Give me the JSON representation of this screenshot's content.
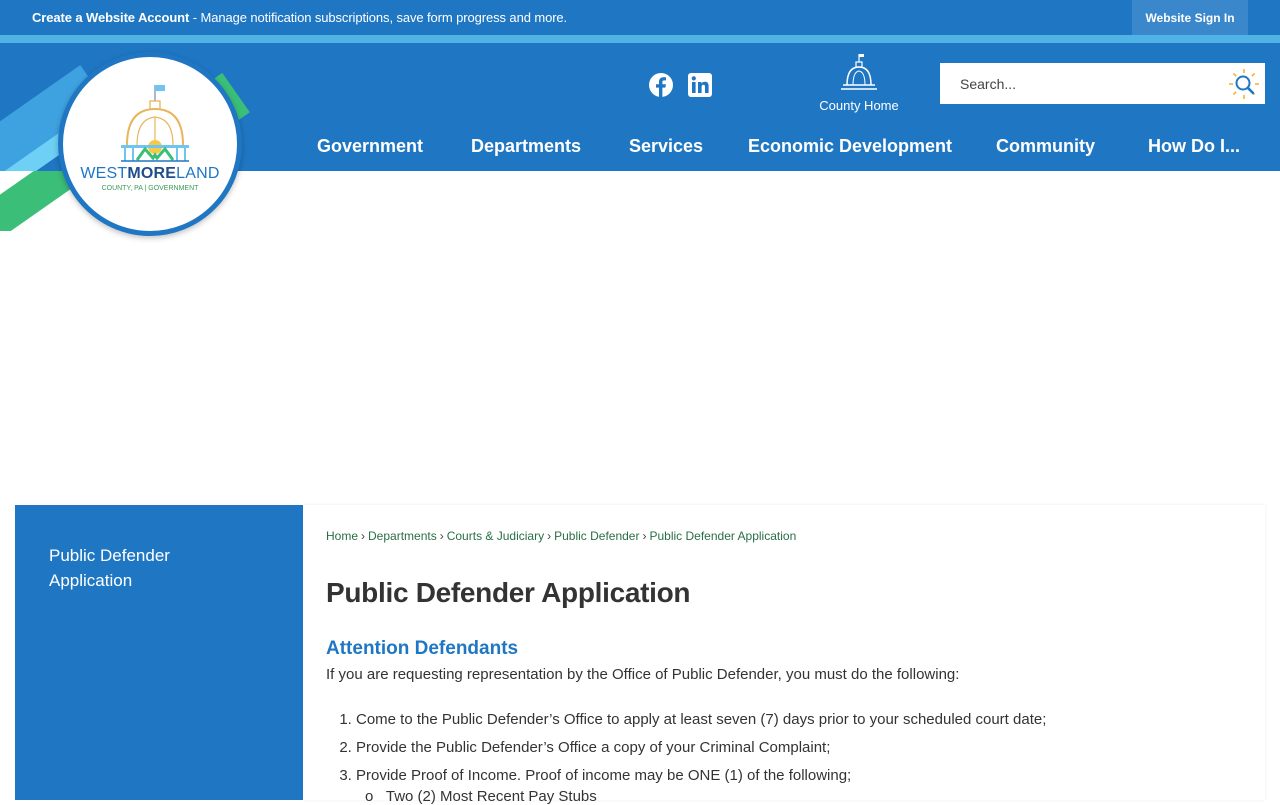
{
  "topbar": {
    "create_account": "Create a Website Account",
    "message": " - Manage notification subscriptions, save form progress and more.",
    "sign_in": "Website Sign In"
  },
  "logo": {
    "word_1": "WEST",
    "word_2": "MORE",
    "word_3": "LAND",
    "sub": "COUNTY, PA | GOVERNMENT"
  },
  "social": {
    "facebook": "facebook-icon",
    "linkedin": "linkedin-icon"
  },
  "county_home": {
    "label": "County Home"
  },
  "search": {
    "placeholder": "Search..."
  },
  "nav": [
    "Government",
    "Departments",
    "Services",
    "Economic Development",
    "Community",
    "How Do I..."
  ],
  "sidebar": {
    "item": "Public Defender Application"
  },
  "breadcrumb": [
    "Home",
    "Departments",
    "Courts & Judiciary",
    "Public Defender",
    "Public Defender Application"
  ],
  "content": {
    "title": "Public Defender Application",
    "section": "Attention Defendants",
    "intro": "If you are requesting representation by the Office of Public Defender, you must do the following:",
    "steps": [
      "Come to the Public Defender’s Office to apply at least seven (7) days prior to your scheduled court date;",
      "Provide the Public Defender’s Office a copy of your Criminal Complaint;",
      "Provide Proof of Income.  Proof of income may be ONE (1) of the following;"
    ],
    "subitems": [
      "Two (2) Most Recent Pay Stubs"
    ]
  },
  "colors": {
    "brand_blue": "#1f77c4",
    "accent_green": "#3bbf78",
    "breadcrumb_green": "#2a6e45"
  }
}
